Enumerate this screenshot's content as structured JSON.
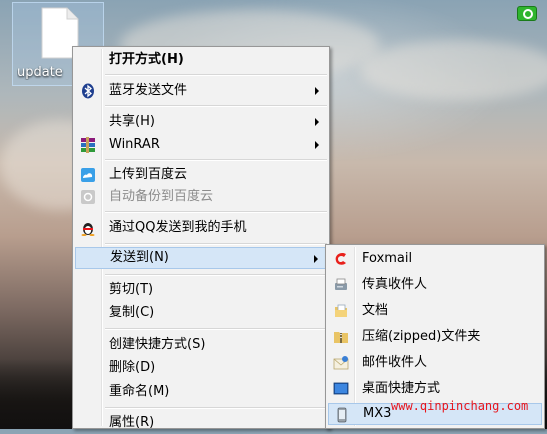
{
  "desktop": {
    "file_label": "update"
  },
  "context_menu": {
    "items": [
      {
        "label": "打开方式(H)",
        "icon": "none"
      },
      {
        "label": "蓝牙发送文件",
        "icon": "bluetooth-icon"
      },
      {
        "label": "共享(H)",
        "icon": "none"
      },
      {
        "label": "WinRAR",
        "icon": "winrar-icon"
      },
      {
        "label": "上传到百度云",
        "icon": "baidu-cloud-icon"
      },
      {
        "label": "自动备份到百度云",
        "icon": "baidu-backup-icon"
      },
      {
        "label": "通过QQ发送到我的手机",
        "icon": "qq-penguin-icon"
      },
      {
        "label": "发送到(N)",
        "icon": "none"
      },
      {
        "label": "剪切(T)",
        "icon": "none"
      },
      {
        "label": "复制(C)",
        "icon": "none"
      },
      {
        "label": "创建快捷方式(S)",
        "icon": "none"
      },
      {
        "label": "删除(D)",
        "icon": "none"
      },
      {
        "label": "重命名(M)",
        "icon": "none"
      },
      {
        "label": "属性(R)",
        "icon": "none"
      }
    ]
  },
  "send_to_menu": {
    "items": [
      {
        "label": "Foxmail",
        "icon": "foxmail-icon"
      },
      {
        "label": "传真收件人",
        "icon": "fax-icon"
      },
      {
        "label": "文档",
        "icon": "documents-icon"
      },
      {
        "label": "压缩(zipped)文件夹",
        "icon": "zip-folder-icon"
      },
      {
        "label": "邮件收件人",
        "icon": "mail-icon"
      },
      {
        "label": "桌面快捷方式",
        "icon": "desktop-icon"
      },
      {
        "label": "MX3",
        "icon": "phone-device-icon"
      }
    ]
  },
  "watermark": "www.qinpinchang.com",
  "colors": {
    "highlight": "#d5e6f7",
    "highlight_border": "#a8c8ea",
    "menu_bg": "#f2f2f2",
    "watermark": "#e8151b"
  }
}
